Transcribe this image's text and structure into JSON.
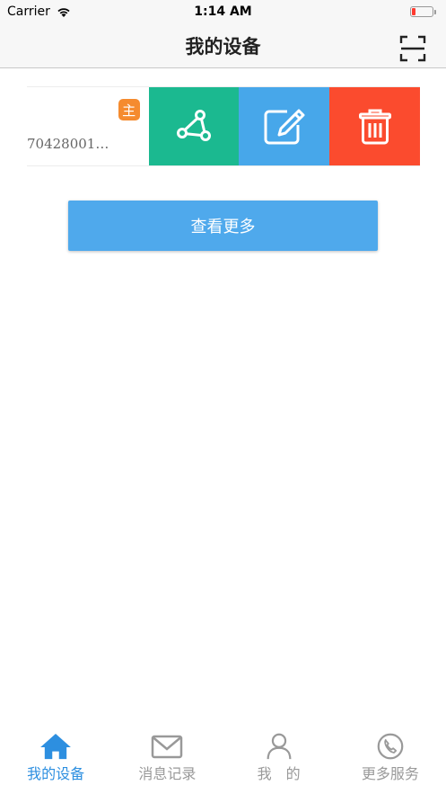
{
  "status_bar": {
    "carrier": "Carrier",
    "time": "1:14 AM"
  },
  "nav": {
    "title": "我的设备"
  },
  "device": {
    "badge": "主",
    "id": "70428001…"
  },
  "view_more": {
    "label": "查看更多"
  },
  "tabs": [
    {
      "label": "我的设备",
      "icon": "home-icon",
      "active": true
    },
    {
      "label": "消息记录",
      "icon": "mail-icon",
      "active": false
    },
    {
      "label": "我　的",
      "icon": "person-icon",
      "active": false
    },
    {
      "label": "更多服务",
      "icon": "phone-icon",
      "active": false
    }
  ],
  "colors": {
    "share": "#1bb990",
    "edit": "#47a7ea",
    "delete": "#fb4b2e",
    "badge": "#f58b2f",
    "button": "#4fa9ec",
    "tab_active": "#2d8fe0",
    "tab_inactive": "#999999"
  }
}
